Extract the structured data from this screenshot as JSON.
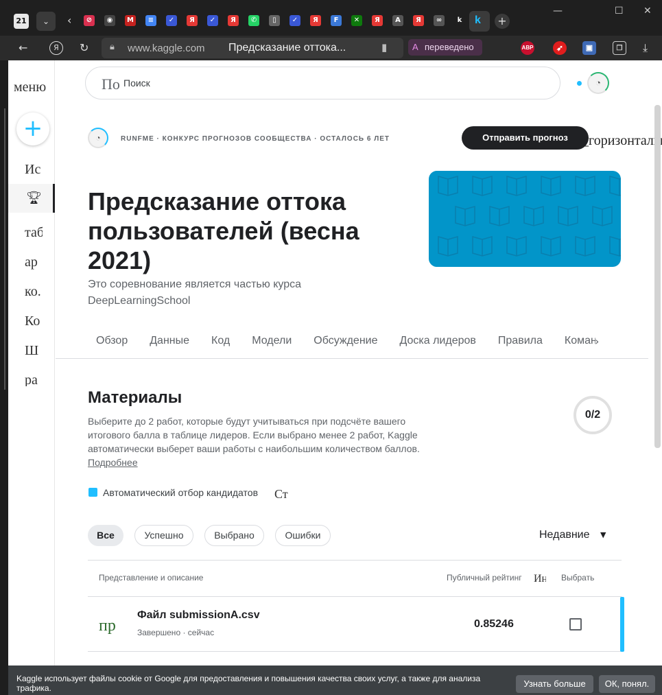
{
  "browser": {
    "tab_count": "21",
    "domain": "www.kaggle.com",
    "page_title": "Предсказание оттока...",
    "translated_badge": "переведено",
    "extension_abp": "ABP",
    "tab_icons": [
      {
        "glyph": "⊘",
        "color": "#d9304f"
      },
      {
        "glyph": "◉",
        "color": "#444"
      },
      {
        "glyph": "M",
        "color": "#c5221f"
      },
      {
        "glyph": "≡",
        "color": "#4285f4"
      },
      {
        "glyph": "✓",
        "color": "#3a58d6"
      },
      {
        "glyph": "Я",
        "color": "#e53935"
      },
      {
        "glyph": "✓",
        "color": "#3a58d6"
      },
      {
        "glyph": "Я",
        "color": "#e53935"
      },
      {
        "glyph": "✆",
        "color": "#25d366"
      },
      {
        "glyph": "▯",
        "color": "#666"
      },
      {
        "glyph": "✓",
        "color": "#3a58d6"
      },
      {
        "glyph": "Я",
        "color": "#e53935"
      },
      {
        "glyph": "F",
        "color": "#3b79d8"
      },
      {
        "glyph": "✕",
        "color": "#0e7a0d"
      },
      {
        "glyph": "Я",
        "color": "#e53935"
      },
      {
        "glyph": "A",
        "color": "#555"
      },
      {
        "glyph": "Я",
        "color": "#e53935"
      },
      {
        "glyph": "∞",
        "color": "#555"
      },
      {
        "glyph": "k",
        "color": "#1f1f1f"
      }
    ]
  },
  "nav": {
    "menu_label": "меню",
    "items": [
      "Ис",
      "таб",
      "ар",
      "ко.",
      "Ко",
      "Ш",
      "ра"
    ]
  },
  "search": {
    "placeholder_serif": "По",
    "placeholder": "Поиск"
  },
  "competition": {
    "host_line": "RUNFME · КОНКУРС ПРОГНОЗОВ СООБЩЕСТВА · ОСТАЛОСЬ 6 ЛЕТ",
    "submit_label": "Отправить прогноз",
    "horizontal_label": "_горизонтально",
    "title": "Предсказание оттока пользователей (весна 2021)",
    "subtitle": "Это соревнование является частью курса DeepLearningSchool",
    "tabs": [
      "Обзор",
      "Данные",
      "Код",
      "Модели",
      "Обсуждение",
      "Доска лидеров",
      "Правила",
      "Команда"
    ]
  },
  "materials": {
    "heading": "Материалы",
    "description": "Выберите до 2 работ, которые будут учитываться при подсчёте вашего итогового балла в таблице лидеров. Если выбрано менее 2 работ, Kaggle автоматически выберет ваши работы с наибольшим количеством баллов.",
    "more_link": "Подробнее",
    "counter": "0/2",
    "auto_select_label": "Автоматический отбор кандидатов",
    "auto_select_serif": "Ст",
    "filters": [
      "Все",
      "Успешно",
      "Выбрано",
      "Ошибки"
    ],
    "sort_label": "Недавние"
  },
  "table": {
    "headers": {
      "submission": "Представление и описание",
      "public_score": "Публичный рейтинг",
      "public_score_serif": "Ин",
      "select": "Выбрать"
    },
    "rows": [
      {
        "icon_text": "пр",
        "title": "Файл submissionA.csv",
        "status": "Завершено · сейчас",
        "score": "0.85246"
      }
    ]
  },
  "cookie": {
    "text": "Kaggle использует файлы cookie от Google для предоставления и повышения качества своих услуг, а также для анализа трафика.",
    "learn_more": "Узнать больше",
    "ok": "ОК, понял."
  },
  "colors": {
    "accent": "#20beff",
    "banner": "#0295c9",
    "dark": "#202124"
  }
}
